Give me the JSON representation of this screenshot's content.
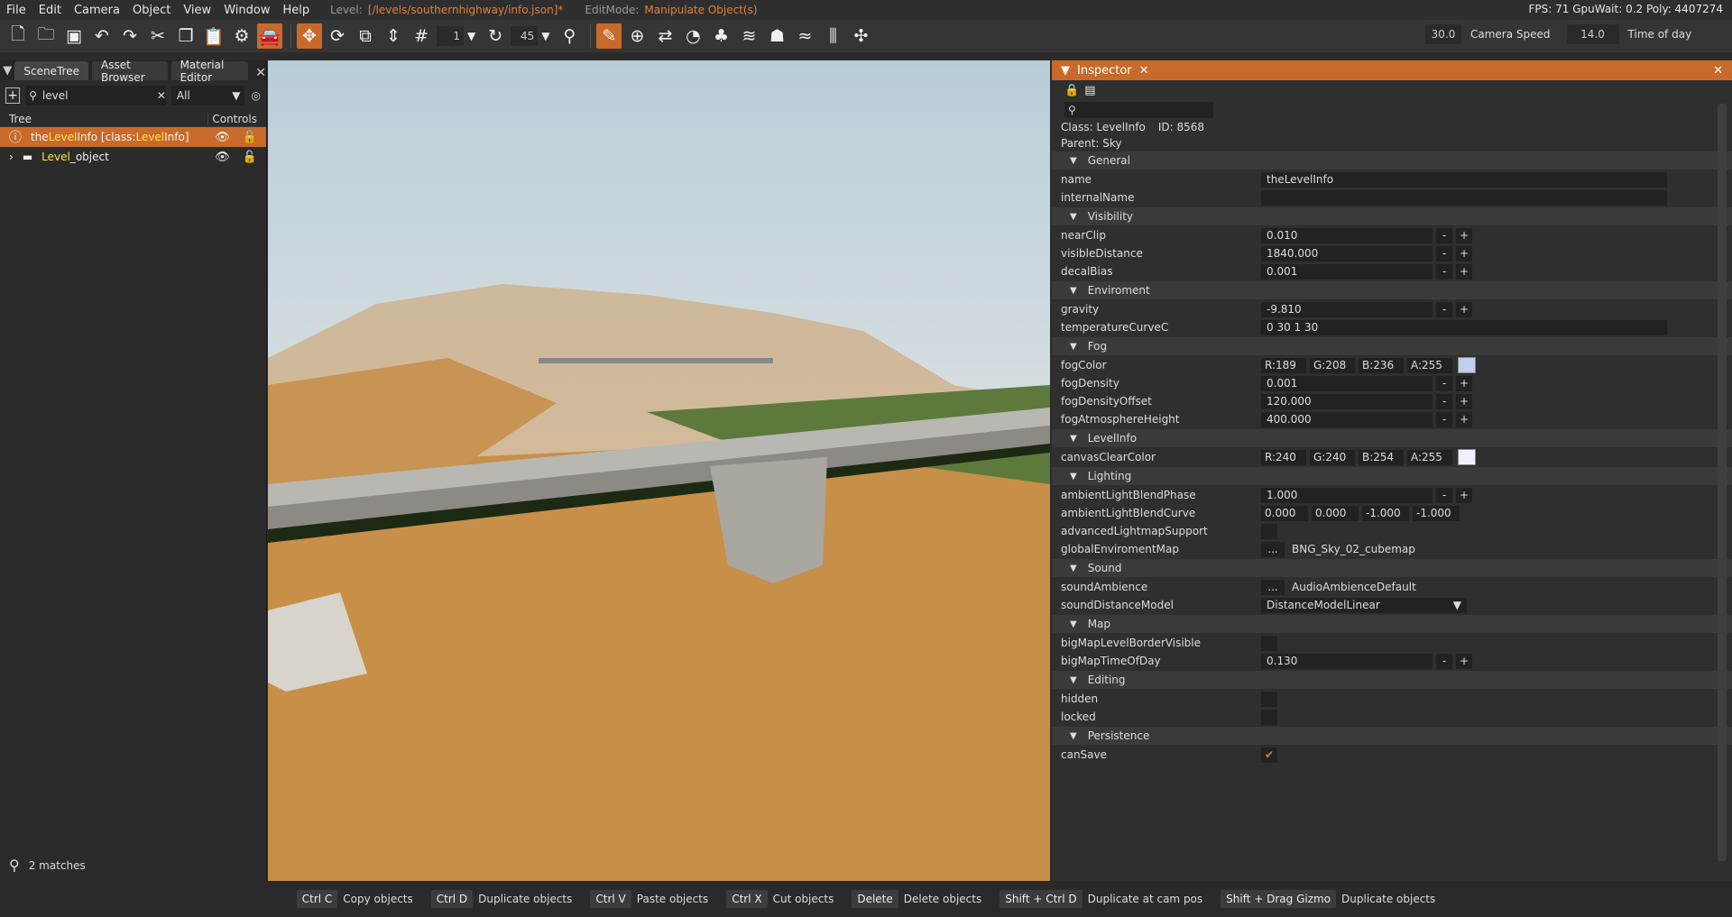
{
  "menu": {
    "items": [
      "File",
      "Edit",
      "Camera",
      "Object",
      "View",
      "Window",
      "Help"
    ],
    "level_label": "Level:",
    "level_value": "[/levels/southernhighway/info.json]*",
    "editmode_label": "EditMode:",
    "editmode_value": "Manipulate Object(s)",
    "stats": "FPS: 71  GpuWait: 0.2  Poly: 4407274"
  },
  "toolbar": {
    "snap_value": "1",
    "rotate_value": "45",
    "cam_speed_value": "30.0",
    "cam_speed_label": "Camera Speed",
    "time_of_day_value": "14.0",
    "time_of_day_label": "Time of day",
    "accent_color": "#c86a2a"
  },
  "left_panel": {
    "tabs": [
      "SceneTree",
      "Asset Browser",
      "Material Editor"
    ],
    "search_value": "level",
    "filter_value": "All",
    "tree_header": "Tree",
    "controls_header": "Controls",
    "rows": [
      {
        "pre": "the",
        "hl": "Level",
        "mid": "Info [class: ",
        "hl2": "Level",
        "post": "Info]"
      },
      {
        "pre": "",
        "hl": "Level",
        "mid": "_object",
        "hl2": "",
        "post": ""
      }
    ],
    "matches": "2 matches"
  },
  "inspector": {
    "title": "Inspector",
    "class_label": "Class:  LevelInfo",
    "id_label": "ID:  8568",
    "parent_label": "Parent:  Sky",
    "groups": {
      "general": "General",
      "visibility": "Visibility",
      "enviroment": "Enviroment",
      "fog": "Fog",
      "levelinfo": "LevelInfo",
      "lighting": "Lighting",
      "sound": "Sound",
      "map": "Map",
      "editing": "Editing",
      "persistence": "Persistence"
    },
    "props": {
      "name": {
        "label": "name",
        "value": "theLevelInfo"
      },
      "internalName": {
        "label": "internalName",
        "value": ""
      },
      "nearClip": {
        "label": "nearClip",
        "value": "0.010"
      },
      "visibleDistance": {
        "label": "visibleDistance",
        "value": "1840.000"
      },
      "decalBias": {
        "label": "decalBias",
        "value": "0.001"
      },
      "gravity": {
        "label": "gravity",
        "value": "-9.810"
      },
      "temperatureCurveC": {
        "label": "temperatureCurveC",
        "value": "0 30 1 30"
      },
      "fogColor": {
        "label": "fogColor",
        "r": "R:189",
        "g": "G:208",
        "b": "B:236",
        "a": "A:255",
        "swatch": "#bdd0ec"
      },
      "fogDensity": {
        "label": "fogDensity",
        "value": "0.001"
      },
      "fogDensityOffset": {
        "label": "fogDensityOffset",
        "value": "120.000"
      },
      "fogAtmosphereHeight": {
        "label": "fogAtmosphereHeight",
        "value": "400.000"
      },
      "canvasClearColor": {
        "label": "canvasClearColor",
        "r": "R:240",
        "g": "G:240",
        "b": "B:254",
        "a": "A:255",
        "swatch": "#f0f0fe"
      },
      "ambientLightBlendPhase": {
        "label": "ambientLightBlendPhase",
        "value": "1.000"
      },
      "ambientLightBlendCurve": {
        "label": "ambientLightBlendCurve",
        "v1": "0.000",
        "v2": "0.000",
        "v3": "-1.000",
        "v4": "-1.000"
      },
      "advancedLightmapSupport": {
        "label": "advancedLightmapSupport"
      },
      "globalEnviromentMap": {
        "label": "globalEnviromentMap",
        "value": "BNG_Sky_02_cubemap"
      },
      "soundAmbience": {
        "label": "soundAmbience",
        "value": "AudioAmbienceDefault"
      },
      "soundDistanceModel": {
        "label": "soundDistanceModel",
        "value": "DistanceModelLinear"
      },
      "bigMapLevelBorderVisible": {
        "label": "bigMapLevelBorderVisible"
      },
      "bigMapTimeOfDay": {
        "label": "bigMapTimeOfDay",
        "value": "0.130"
      },
      "hidden": {
        "label": "hidden"
      },
      "locked": {
        "label": "locked"
      },
      "canSave": {
        "label": "canSave"
      }
    }
  },
  "statusbar": [
    {
      "key": "Ctrl C",
      "desc": "Copy objects"
    },
    {
      "key": "Ctrl D",
      "desc": "Duplicate objects"
    },
    {
      "key": "Ctrl V",
      "desc": "Paste objects"
    },
    {
      "key": "Ctrl X",
      "desc": "Cut objects"
    },
    {
      "key": "Delete",
      "desc": "Delete objects"
    },
    {
      "key": "Shift + Ctrl D",
      "desc": "Duplicate at cam pos"
    },
    {
      "key": "Shift + Drag Gizmo",
      "desc": "Duplicate objects"
    }
  ]
}
